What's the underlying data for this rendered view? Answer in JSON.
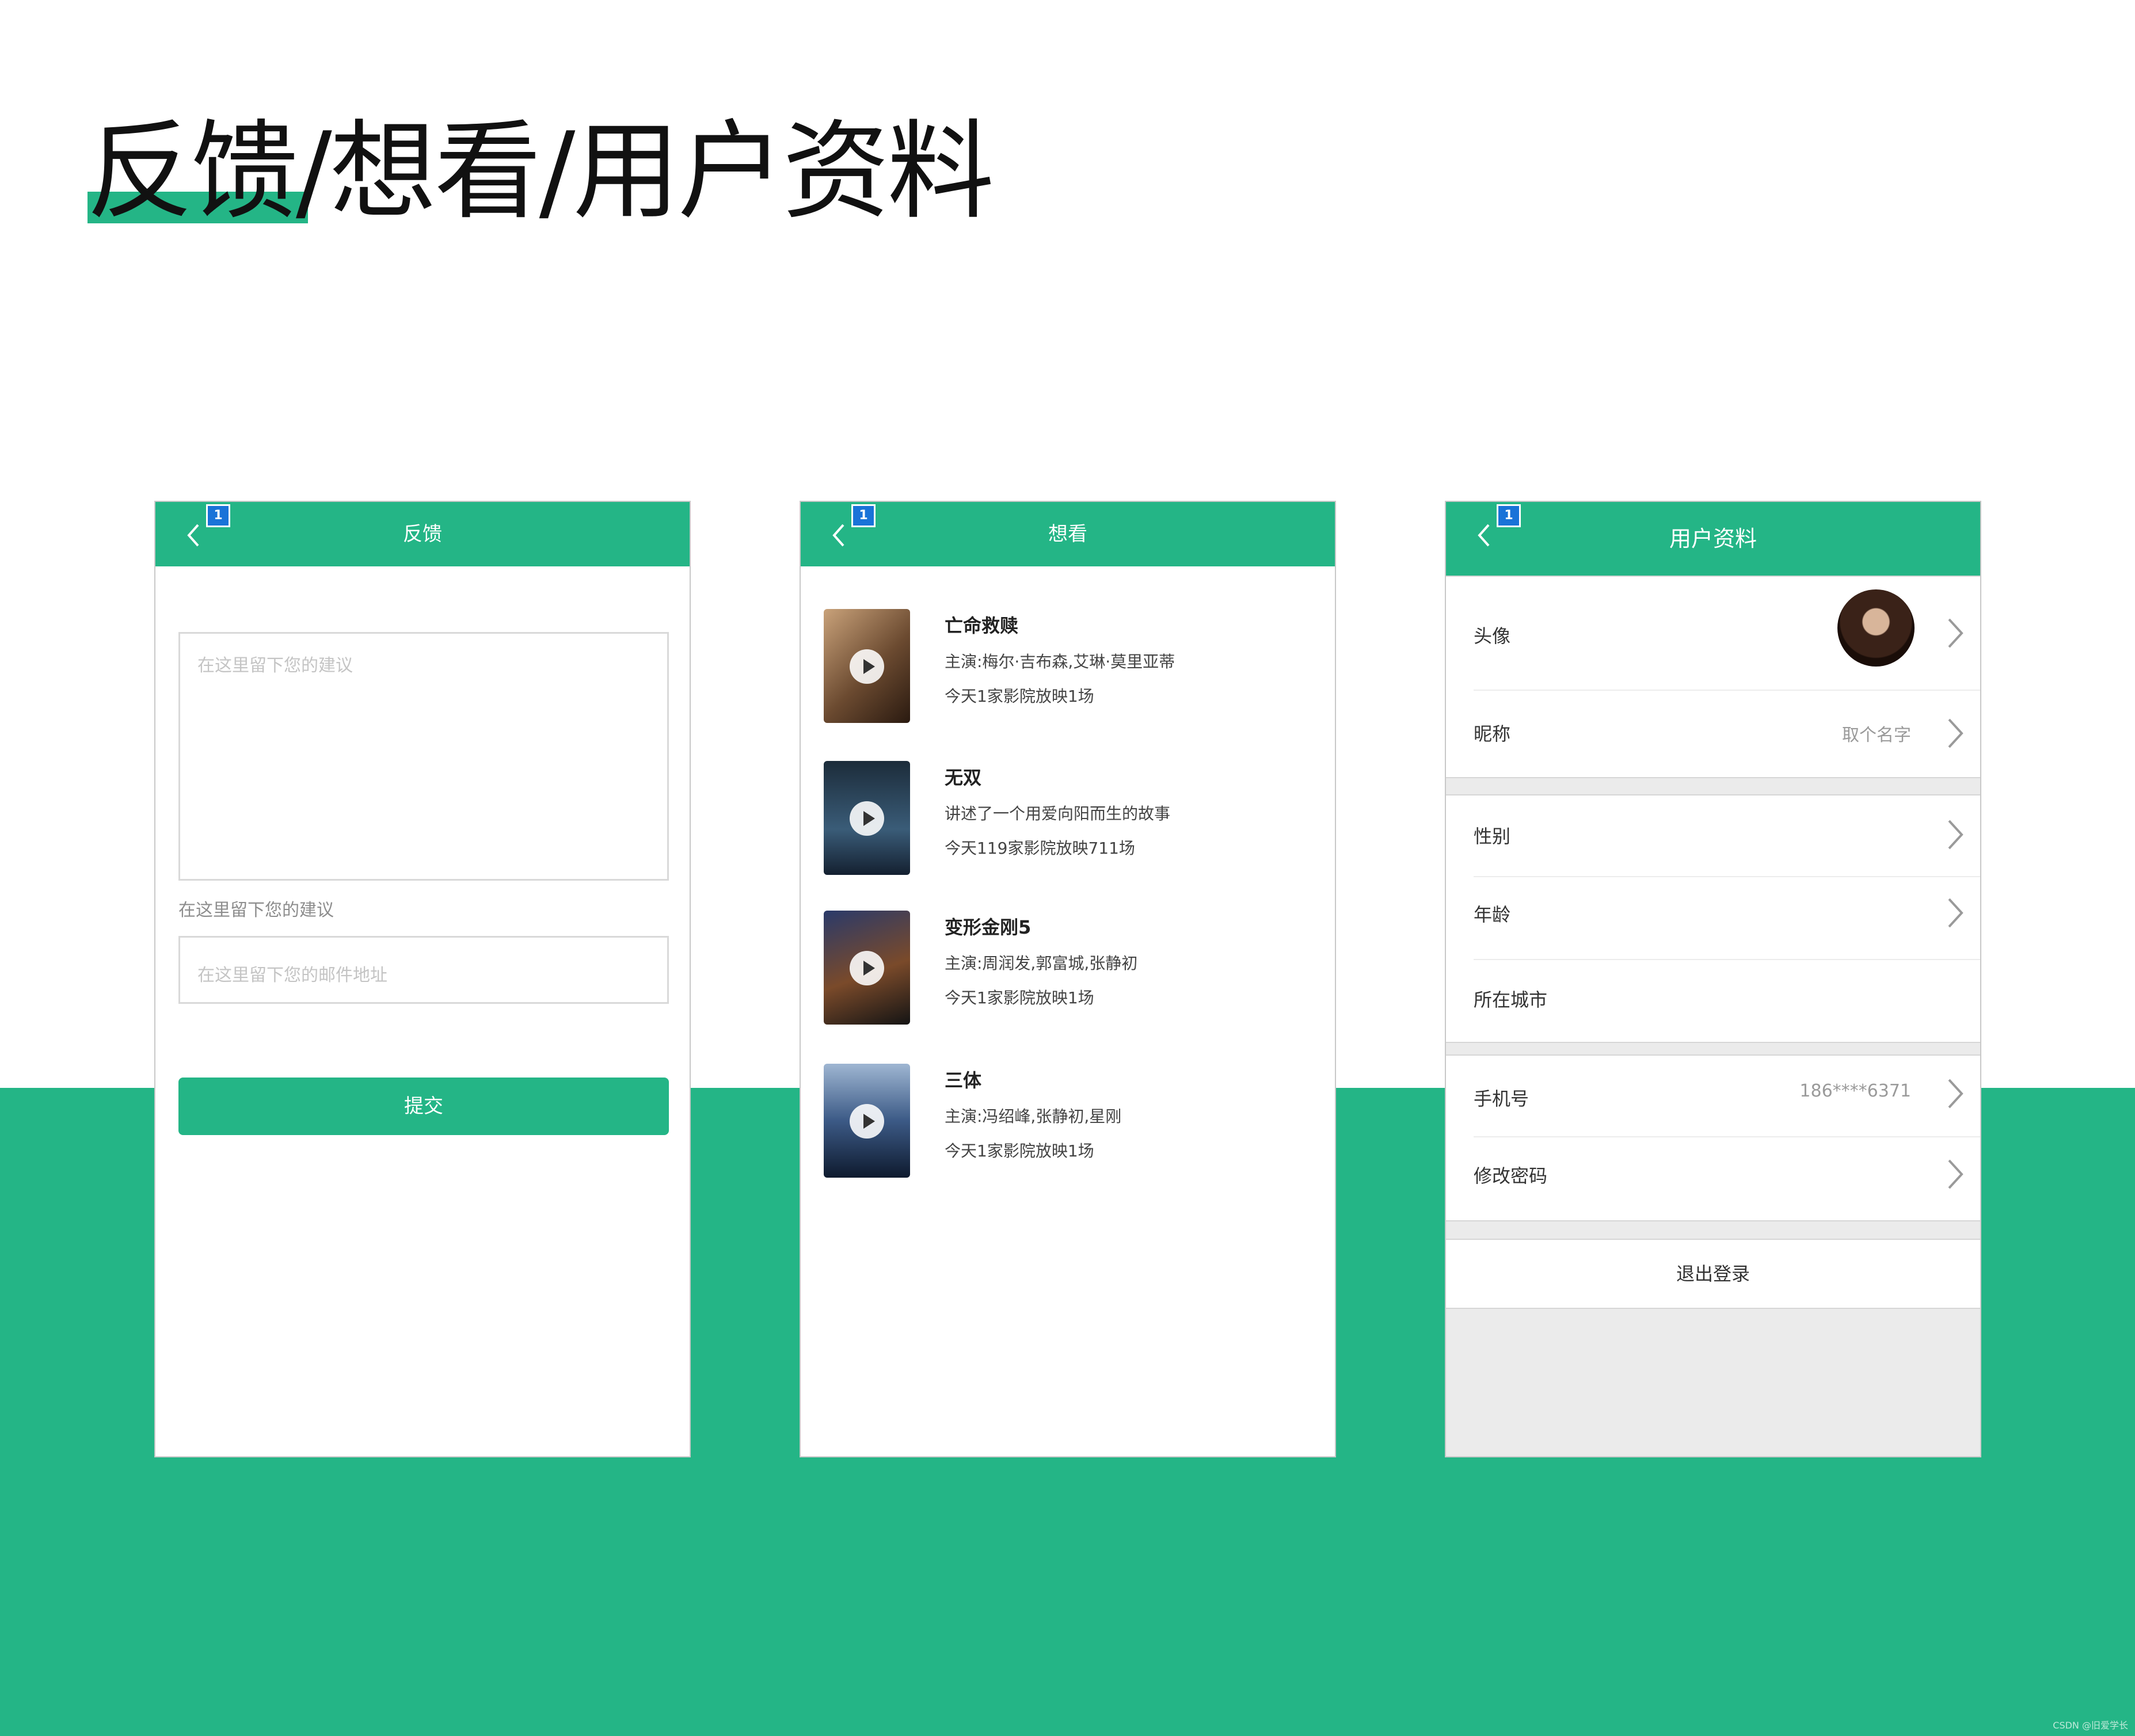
{
  "page": {
    "title": "反馈/想看/用户资料",
    "watermark": "CSDN @旧爱学长"
  },
  "feedback": {
    "nav_badge": "1",
    "nav_title": "反馈",
    "suggestion_placeholder": "在这里留下您的建议",
    "hint_text": "在这里留下您的建议",
    "email_placeholder": "在这里留下您的邮件地址",
    "submit_label": "提交"
  },
  "want": {
    "nav_badge": "1",
    "nav_title": "想看",
    "movies": [
      {
        "title": "亡命救赎",
        "line1": "主演:梅尔·吉布森,艾琳·莫里亚蒂",
        "line2": "今天1家影院放映1场"
      },
      {
        "title": "无双",
        "line1": "讲述了一个用爱向阳而生的故事",
        "line2": "今天119家影院放映711场"
      },
      {
        "title": "变形金刚5",
        "line1": "主演:周润发,郭富城,张静初",
        "line2": "今天1家影院放映1场"
      },
      {
        "title": "三体",
        "line1": "主演:冯绍峰,张静初,星刚",
        "line2": "今天1家影院放映1场"
      }
    ]
  },
  "profile": {
    "nav_badge": "1",
    "nav_title": "用户资料",
    "avatar_label": "头像",
    "nickname_label": "昵称",
    "nickname_value": "取个名字",
    "gender_label": "性别",
    "age_label": "年龄",
    "city_label": "所在城市",
    "phone_label": "手机号",
    "phone_value": "186****6371",
    "password_label": "修改密码",
    "logout_label": "退出登录"
  },
  "colors": {
    "brand_green": "#24b586",
    "badge_blue": "#1a73d8"
  }
}
